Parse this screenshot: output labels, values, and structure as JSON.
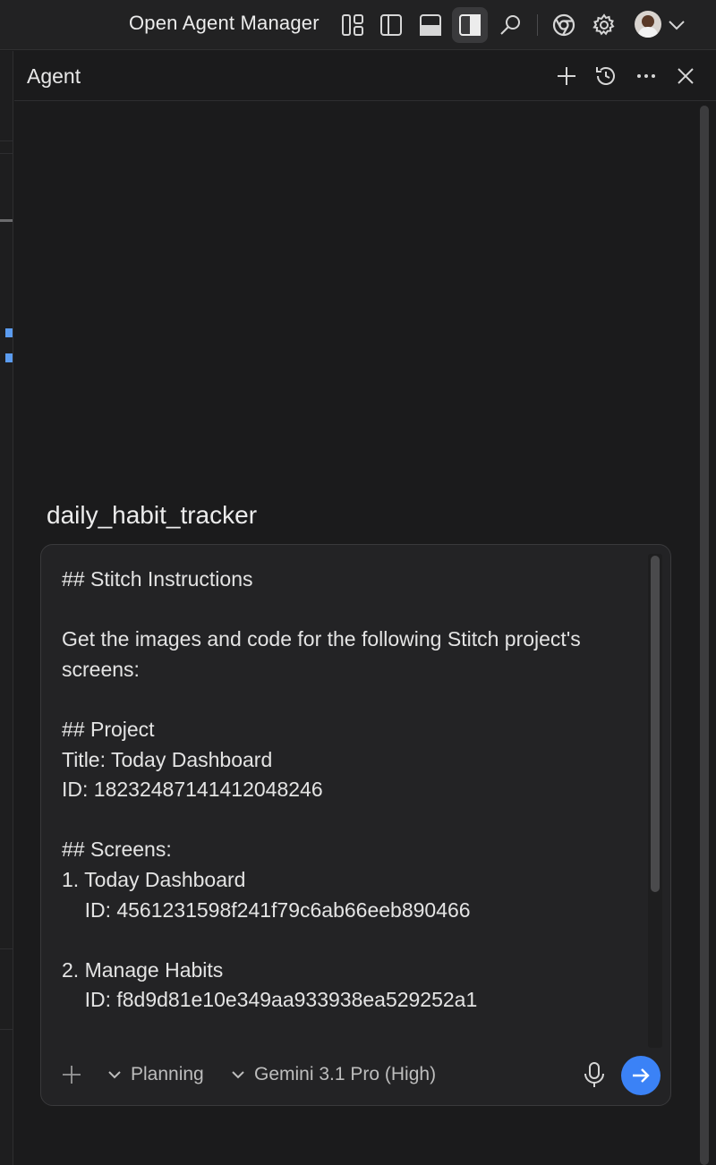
{
  "titlebar": {
    "manager_label": "Open Agent Manager",
    "icons": [
      "layout-icon",
      "sidebar-left-icon",
      "panel-bottom-icon",
      "sidebar-right-icon",
      "search-icon",
      "chrome-icon",
      "gear-icon",
      "avatar",
      "chevron-down-icon"
    ]
  },
  "panel": {
    "title": "Agent",
    "actions": [
      "plus-icon",
      "history-icon",
      "more-icon",
      "close-icon"
    ]
  },
  "conversation": {
    "title": "daily_habit_tracker"
  },
  "composer": {
    "text": "## Stitch Instructions\n\nGet the images and code for the following Stitch project's screens:\n\n## Project\nTitle: Today Dashboard\nID: 18232487141412048246\n\n## Screens:\n1. Today Dashboard\n    ID: 4561231598f241f79c6ab66eeb890466\n\n2. Manage Habits\n    ID: f8d9d81e10e349aa933938ea529252a1",
    "mode_label": "Planning",
    "model_label": "Gemini 3.1 Pro (High)"
  },
  "colors": {
    "accent": "#3b82f6",
    "background": "#1b1b1c",
    "surface": "#232325"
  }
}
